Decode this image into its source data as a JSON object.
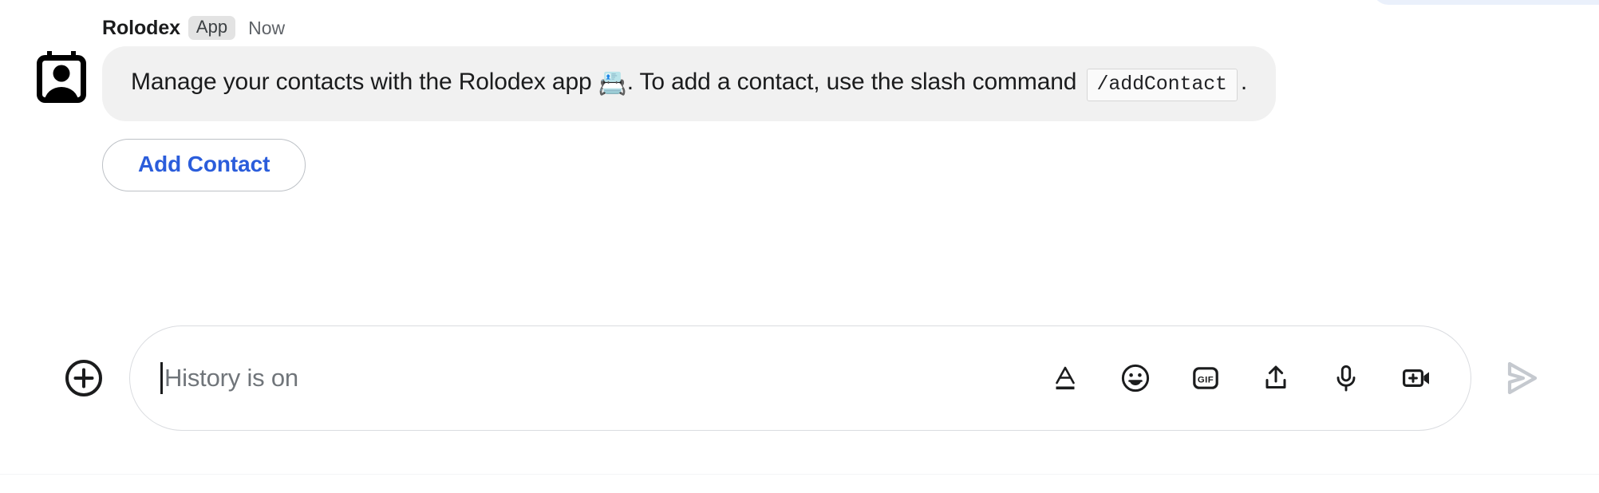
{
  "colors": {
    "accent_blue": "#2b5ddb",
    "bubble_bg": "#f1f1f1",
    "badge_bg": "#e3e3e3",
    "text_primary": "#1b1c1d",
    "text_secondary": "#5f6368",
    "placeholder": "#70757a",
    "border": "#dadce0",
    "send_disabled": "#c5c9cf",
    "prev_bubble": "#eaf0fb"
  },
  "message": {
    "sender": "Rolodex",
    "badge": "App",
    "timestamp": "Now",
    "avatar_icon": "rolodex-card-person-icon",
    "body": {
      "part1": "Manage your contacts with the Rolodex app ",
      "emoji": "📇",
      "part2": ". To add a contact, use the slash command ",
      "code": "/addContact",
      "part3": "."
    },
    "action_button": {
      "label": "Add Contact",
      "icon": "none"
    }
  },
  "composer": {
    "add_icon": "plus-circle-icon",
    "placeholder": "History is on",
    "value": "",
    "caret_visible": true,
    "tools": [
      {
        "name": "format-text-icon",
        "label": "Format"
      },
      {
        "name": "emoji-icon",
        "label": "Emoji"
      },
      {
        "name": "gif-icon",
        "label": "GIF"
      },
      {
        "name": "upload-file-icon",
        "label": "Upload file"
      },
      {
        "name": "microphone-icon",
        "label": "Voice message"
      },
      {
        "name": "video-add-icon",
        "label": "Add video meeting"
      }
    ],
    "send_icon": "send-paper-plane-icon",
    "send_enabled": false
  }
}
